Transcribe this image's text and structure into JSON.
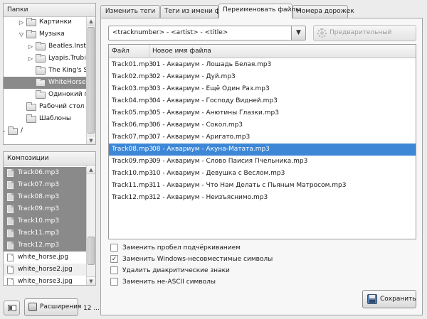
{
  "folders_pane": {
    "header": "Папки",
    "tree": [
      {
        "label": "Картинки",
        "depth": 2,
        "expander": "right",
        "selected": false
      },
      {
        "label": "Музыка",
        "depth": 2,
        "expander": "down",
        "selected": false
      },
      {
        "label": "Beatles.Instrume",
        "depth": 3,
        "expander": "right",
        "selected": false
      },
      {
        "label": "Lyapis.Trubickov",
        "depth": 3,
        "expander": "right",
        "selected": false
      },
      {
        "label": "The King's Singe",
        "depth": 3,
        "expander": "none",
        "selected": false
      },
      {
        "label": "WhiteHorse320",
        "depth": 3,
        "expander": "none",
        "selected": true
      },
      {
        "label": "Одинокий паст",
        "depth": 3,
        "expander": "none",
        "selected": false
      },
      {
        "label": "Рабочий стол",
        "depth": 2,
        "expander": "none",
        "selected": false
      },
      {
        "label": "Шаблоны",
        "depth": 2,
        "expander": "none",
        "selected": false
      },
      {
        "label": "/",
        "depth": 0,
        "expander": "right",
        "selected": false
      }
    ]
  },
  "tracks_pane": {
    "header": "Композиции",
    "files": [
      {
        "name": "Track06.mp3",
        "selected": true
      },
      {
        "name": "Track07.mp3",
        "selected": true
      },
      {
        "name": "Track08.mp3",
        "selected": true
      },
      {
        "name": "Track09.mp3",
        "selected": true
      },
      {
        "name": "Track10.mp3",
        "selected": true
      },
      {
        "name": "Track11.mp3",
        "selected": true
      },
      {
        "name": "Track12.mp3",
        "selected": true
      },
      {
        "name": "white_horse.jpg",
        "selected": false
      },
      {
        "name": "white_horse2.jpg",
        "selected": false
      },
      {
        "name": "white_horse3.jpg",
        "selected": false
      }
    ]
  },
  "bottom_bar": {
    "extensions_label": "Расширения",
    "count_text": "12 ..."
  },
  "tabs": [
    {
      "label": "Изменить теги",
      "active": false
    },
    {
      "label": "Теги из имени файла",
      "active": false
    },
    {
      "label": "Переименовать файлы",
      "active": true
    },
    {
      "label": "Номера дорожек",
      "active": false
    }
  ],
  "rename": {
    "pattern": "<tracknumber> - <artist> - <title>",
    "preview_label": "Предварительный просмотр",
    "columns": {
      "file": "Файл",
      "new_name": "Новое имя файла"
    },
    "rows": [
      {
        "file": "Track01.mp3",
        "new_name": "01 - Аквариум - Лошадь Белая.mp3",
        "selected": false
      },
      {
        "file": "Track02.mp3",
        "new_name": "02 - Аквариум - Дуй.mp3",
        "selected": false
      },
      {
        "file": "Track03.mp3",
        "new_name": "03 - Аквариум - Ещё Один Раз.mp3",
        "selected": false
      },
      {
        "file": "Track04.mp3",
        "new_name": "04 - Аквариум - Господу Видней.mp3",
        "selected": false
      },
      {
        "file": "Track05.mp3",
        "new_name": "05 - Аквариум - Анютины Глазки.mp3",
        "selected": false
      },
      {
        "file": "Track06.mp3",
        "new_name": "06 - Аквариум - Сокол.mp3",
        "selected": false
      },
      {
        "file": "Track07.mp3",
        "new_name": "07 - Аквариум - Аригато.mp3",
        "selected": false
      },
      {
        "file": "Track08.mp3",
        "new_name": "08 - Аквариум - Акуна-Матата.mp3",
        "selected": true
      },
      {
        "file": "Track09.mp3",
        "new_name": "09 - Аквариум - Слово Паисия Пчельника.mp3",
        "selected": false
      },
      {
        "file": "Track10.mp3",
        "new_name": "10 - Аквариум - Девушка с Веслом.mp3",
        "selected": false
      },
      {
        "file": "Track11.mp3",
        "new_name": "11 - Аквариум - Что Нам Делать с Пьяным Матросом.mp3",
        "selected": false
      },
      {
        "file": "Track12.mp3",
        "new_name": "12 - Аквариум - Неизъяснимо.mp3",
        "selected": false
      }
    ],
    "options": [
      {
        "label": "Заменить пробел подчёркиванием",
        "checked": false
      },
      {
        "label": "Заменить Windows-несовместимые символы",
        "checked": true
      },
      {
        "label": "Удалить диакритические знаки",
        "checked": false
      },
      {
        "label": "Заменить не-ASCII символы",
        "checked": false
      }
    ],
    "save_label": "Сохранить"
  },
  "colors": {
    "selection_blue": "#3d87d6",
    "selection_gray": "#8a8a8a"
  }
}
